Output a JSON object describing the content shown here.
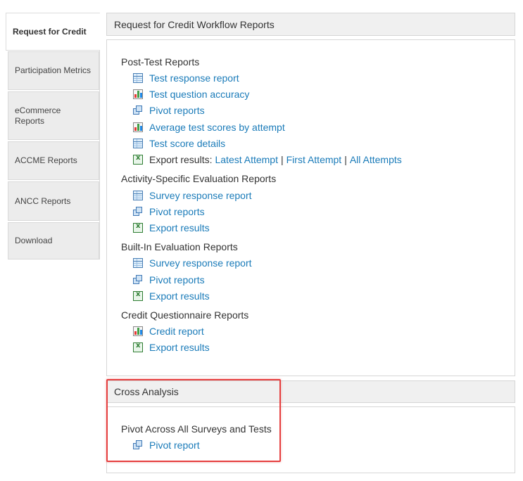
{
  "sidebar": {
    "items": [
      {
        "label": "Request for Credit"
      },
      {
        "label": "Participation Metrics"
      },
      {
        "label": "eCommerce Reports"
      },
      {
        "label": "ACCME Reports"
      },
      {
        "label": "ANCC Reports"
      },
      {
        "label": "Download"
      }
    ]
  },
  "main_panel": {
    "title": "Request for Credit Workflow Reports",
    "sections": [
      {
        "title": "Post-Test Reports",
        "items": [
          {
            "icon": "table-icon",
            "label": "Test response report"
          },
          {
            "icon": "bar-chart-icon",
            "label": "Test question accuracy"
          },
          {
            "icon": "pivot-icon",
            "label": "Pivot reports"
          },
          {
            "icon": "bar-chart-icon",
            "label": "Average test scores by attempt"
          },
          {
            "icon": "table-icon",
            "label": "Test score details"
          }
        ],
        "export": {
          "icon": "excel-icon",
          "prefix": "Export results:",
          "links": [
            "Latest Attempt",
            "First Attempt",
            "All Attempts"
          ],
          "separator": "|"
        }
      },
      {
        "title": "Activity-Specific Evaluation Reports",
        "items": [
          {
            "icon": "table-icon",
            "label": "Survey response report"
          },
          {
            "icon": "pivot-icon",
            "label": "Pivot reports"
          },
          {
            "icon": "excel-icon",
            "label": "Export results"
          }
        ]
      },
      {
        "title": "Built-In Evaluation Reports",
        "items": [
          {
            "icon": "table-icon",
            "label": "Survey response report"
          },
          {
            "icon": "pivot-icon",
            "label": "Pivot reports"
          },
          {
            "icon": "excel-icon",
            "label": "Export results"
          }
        ]
      },
      {
        "title": "Credit Questionnaire Reports",
        "items": [
          {
            "icon": "bar-chart-icon",
            "label": "Credit report"
          },
          {
            "icon": "excel-icon",
            "label": "Export results"
          }
        ]
      }
    ]
  },
  "cross_panel": {
    "title": "Cross Analysis",
    "section_title": "Pivot Across All Surveys and Tests",
    "items": [
      {
        "icon": "pivot-icon",
        "label": "Pivot report"
      }
    ]
  },
  "colors": {
    "link": "#1a7bb9",
    "highlight": "#e53e3e",
    "header_bg": "#f0f0f0",
    "tab_bg": "#ececec"
  }
}
